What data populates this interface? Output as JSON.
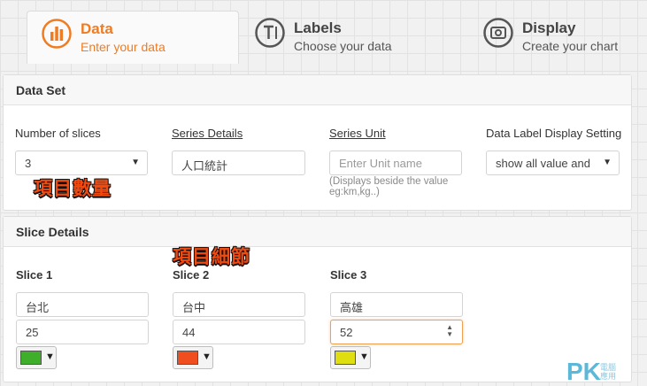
{
  "tabs": [
    {
      "title": "Data",
      "subtitle": "Enter your data",
      "icon": "bar-chart-icon",
      "active": true
    },
    {
      "title": "Labels",
      "subtitle": "Choose your data",
      "icon": "text-tool-icon",
      "active": false
    },
    {
      "title": "Display",
      "subtitle": "Create your chart",
      "icon": "display-icon",
      "active": false
    }
  ],
  "data_set": {
    "heading": "Data Set",
    "slices_label": "Number of slices",
    "slices_value": "3",
    "series_details_label": "Series Details",
    "series_details_value": "人口統計",
    "series_unit_label": "Series Unit",
    "series_unit_placeholder": "Enter Unit name",
    "series_unit_hint_1": "(Displays beside the value",
    "series_unit_hint_2": "eg:km,kg..)",
    "data_label_setting_label": "Data Label Display Setting",
    "data_label_setting_value": "show all value and"
  },
  "slice_details": {
    "heading": "Slice Details",
    "slices": [
      {
        "label": "Slice 1",
        "name": "台北",
        "value": "25",
        "color": "#3fae2a"
      },
      {
        "label": "Slice 2",
        "name": "台中",
        "value": "44",
        "color": "#f04e1f"
      },
      {
        "label": "Slice 3",
        "name": "高雄",
        "value": "52",
        "color": "#dede10"
      }
    ]
  },
  "annotations": {
    "slice_count": "項目數量",
    "slice_details": "項目細節"
  },
  "watermark": {
    "logo": "PK",
    "text_1": "電腦",
    "text_2": "應用"
  }
}
